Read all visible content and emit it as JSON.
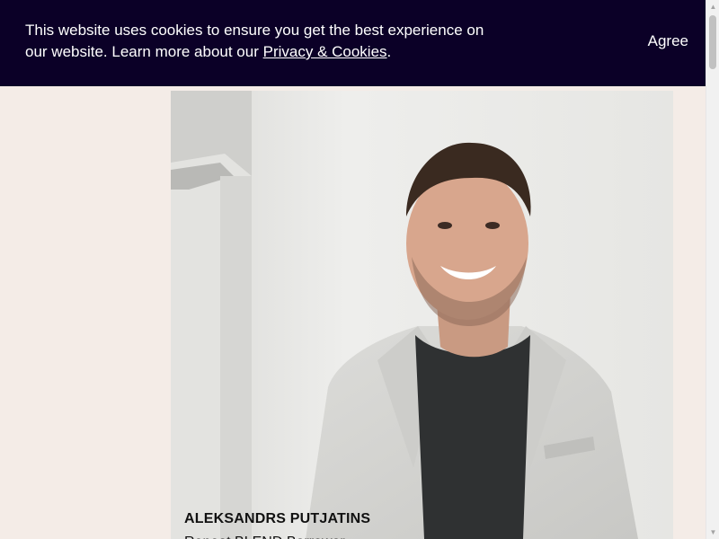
{
  "cookie_banner": {
    "text_before_link": "This website uses cookies to ensure you get the best experience on our website. Learn more about our ",
    "link_text": "Privacy & Cookies",
    "text_after_link": ".",
    "agree_label": "Agree"
  },
  "profile": {
    "name": "ALEKSANDRS PUTJATINS",
    "role": "Repeat BLEND Borrower"
  },
  "scrollbar": {
    "up_icon": "chevron-up-icon",
    "down_icon": "chevron-down-icon"
  }
}
